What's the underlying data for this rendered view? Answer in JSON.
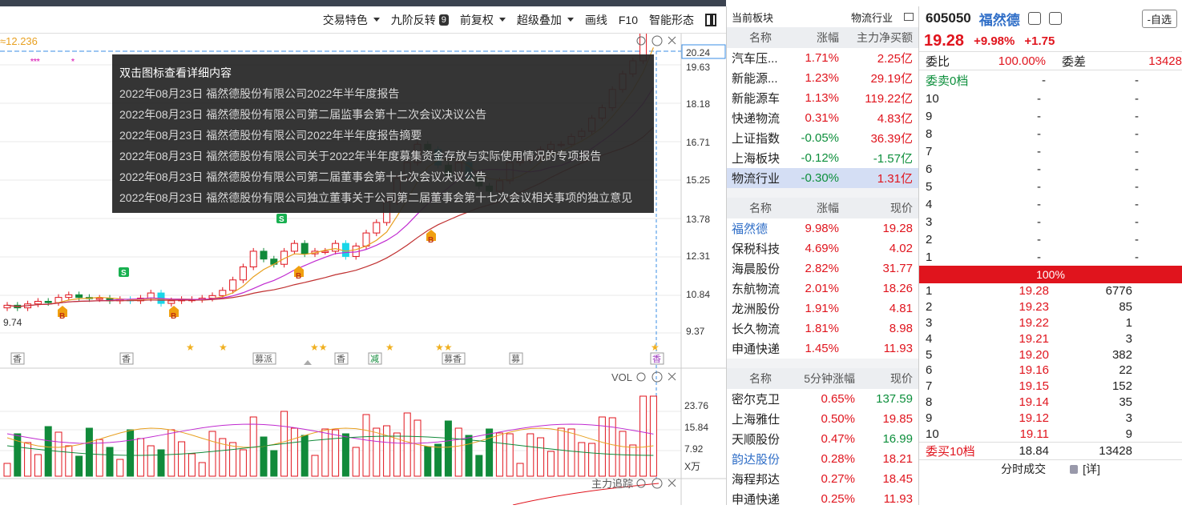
{
  "toolbar": {
    "items": [
      "交易特色",
      "九阶反转",
      "前复权",
      "超级叠加",
      "画线",
      "F10",
      "智能形态"
    ],
    "badge": "9"
  },
  "chart": {
    "ma_label": "≈12.236",
    "price_axis": [
      "20.24",
      "19.63",
      "18.18",
      "16.71",
      "15.25",
      "13.78",
      "12.31",
      "10.84",
      "9.37"
    ],
    "low_label": "9.74",
    "event_tags": [
      "香",
      "香",
      "募派",
      "香",
      "减",
      "募香",
      "募",
      "香"
    ],
    "vol_title": "VOL",
    "vol_axis": [
      "23.76",
      "15.84",
      "7.92",
      "X万"
    ],
    "main_force_title": "主力追踪",
    "colors": {
      "up": "#e0141d",
      "down": "#118a3a",
      "cyan": "#19d6e8",
      "ma5": "#e8a020",
      "ma10": "#c02ad0"
    }
  },
  "tooltip": {
    "title": "双击图标查看详细内容",
    "items": [
      "2022年08月23日 福然德股份有限公司2022年半年度报告",
      "2022年08月23日 福然德股份有限公司第二届监事会第十二次会议决议公告",
      "2022年08月23日 福然德股份有限公司2022年半年度报告摘要",
      "2022年08月23日 福然德股份有限公司关于2022年半年度募集资金存放与实际使用情况的专项报告",
      "2022年08月23日 福然德股份有限公司第二届董事会第十七次会议决议公告",
      "2022年08月23日 福然德股份有限公司独立董事关于公司第二届董事会第十七次会议相关事项的独立意见"
    ]
  },
  "sector": {
    "current_label": "当前板块",
    "current_value": "物流行业",
    "t1_headers": [
      "名称",
      "涨幅",
      "主力净买额"
    ],
    "t1_rows": [
      [
        "汽车压...",
        "1.71%",
        "2.25亿"
      ],
      [
        "新能源...",
        "1.23%",
        "29.19亿"
      ],
      [
        "新能源车",
        "1.13%",
        "119.22亿"
      ],
      [
        "快递物流",
        "0.31%",
        "4.83亿"
      ],
      [
        "上证指数",
        "-0.05%",
        "36.39亿"
      ],
      [
        "上海板块",
        "-0.12%",
        "-1.57亿"
      ],
      [
        "物流行业",
        "-0.30%",
        "1.31亿"
      ]
    ],
    "t2_headers": [
      "名称",
      "涨幅",
      "现价"
    ],
    "t2_rows": [
      [
        "福然德",
        "9.98%",
        "19.28"
      ],
      [
        "保税科技",
        "4.69%",
        "4.02"
      ],
      [
        "海晨股份",
        "2.82%",
        "31.77"
      ],
      [
        "东航物流",
        "2.01%",
        "18.26"
      ],
      [
        "龙洲股份",
        "1.91%",
        "4.81"
      ],
      [
        "长久物流",
        "1.81%",
        "8.98"
      ],
      [
        "申通快递",
        "1.45%",
        "11.93"
      ]
    ],
    "t3_headers": [
      "名称",
      "5分钟涨幅",
      "现价"
    ],
    "t3_rows": [
      [
        "密尔克卫",
        "0.65%",
        "137.59"
      ],
      [
        "上海雅仕",
        "0.50%",
        "19.85"
      ],
      [
        "天顺股份",
        "0.47%",
        "16.99"
      ],
      [
        "韵达股份",
        "0.28%",
        "18.21"
      ],
      [
        "海程邦达",
        "0.27%",
        "18.45"
      ],
      [
        "申通快递",
        "0.25%",
        "11.93"
      ]
    ]
  },
  "quote": {
    "code": "605050",
    "name": "福然德",
    "watch_btn": "-自选",
    "price": "19.28",
    "change_pct": "+9.98%",
    "change": "+1.75",
    "weibi_label": "委比",
    "weibi_value": "100.00%",
    "weicha_label": "委差",
    "weicha_value": "13428",
    "sell_head": "委卖0档",
    "dash": "-",
    "sell_levels": [
      "10",
      "9",
      "8",
      "7",
      "6",
      "5",
      "4",
      "3",
      "2",
      "1"
    ],
    "bar_text": "100%",
    "buy_levels": [
      [
        "1",
        "19.28",
        "6776"
      ],
      [
        "2",
        "19.23",
        "85"
      ],
      [
        "3",
        "19.22",
        "1"
      ],
      [
        "4",
        "19.21",
        "3"
      ],
      [
        "5",
        "19.20",
        "382"
      ],
      [
        "6",
        "19.16",
        "22"
      ],
      [
        "7",
        "19.15",
        "152"
      ],
      [
        "8",
        "19.14",
        "35"
      ],
      [
        "9",
        "19.12",
        "3"
      ],
      [
        "10",
        "19.11",
        "9"
      ]
    ],
    "buy_total_label": "委买10档",
    "buy_total_price": "18.84",
    "buy_total_vol": "13428",
    "foot_trades": "分时成交",
    "foot_detail": "[详]"
  }
}
